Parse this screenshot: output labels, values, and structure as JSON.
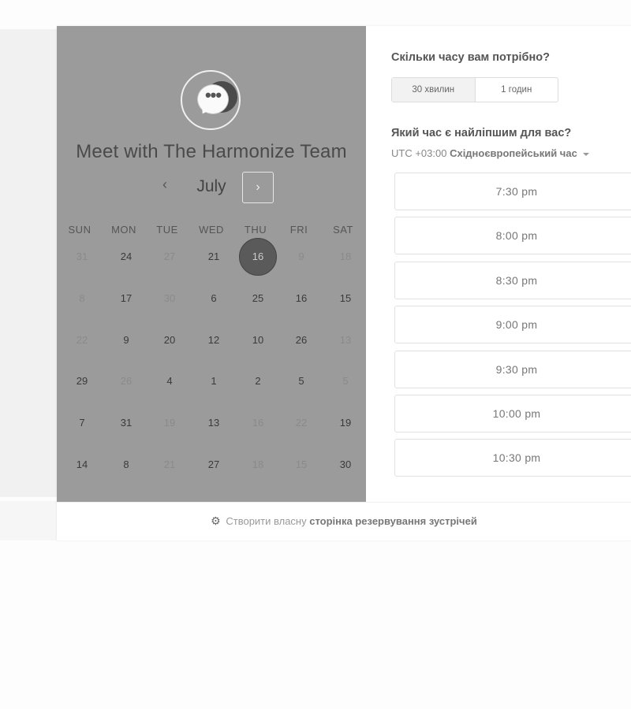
{
  "calendar": {
    "title": "Meet with The Harmonize Team",
    "month": "July",
    "prev_icon": "‹",
    "next_icon": "›",
    "weekdays": [
      "SUN",
      "MON",
      "TUE",
      "WED",
      "THU",
      "FRI",
      "SAT"
    ],
    "days": [
      [
        {
          "t": "31",
          "m": true
        },
        {
          "t": "24",
          "m": false
        },
        {
          "t": "27",
          "m": true
        },
        {
          "t": "21",
          "m": false
        },
        {
          "t": "16",
          "m": false,
          "sel": true
        },
        {
          "t": "9",
          "m": true
        },
        {
          "t": "18",
          "m": true
        }
      ],
      [
        {
          "t": "8",
          "m": true
        },
        {
          "t": "17",
          "m": false
        },
        {
          "t": "30",
          "m": true
        },
        {
          "t": "6",
          "m": false
        },
        {
          "t": "25",
          "m": false
        },
        {
          "t": "16",
          "m": false
        },
        {
          "t": "15",
          "m": false
        }
      ],
      [
        {
          "t": "22",
          "m": true
        },
        {
          "t": "9",
          "m": false
        },
        {
          "t": "20",
          "m": false
        },
        {
          "t": "12",
          "m": false
        },
        {
          "t": "10",
          "m": false
        },
        {
          "t": "26",
          "m": false
        },
        {
          "t": "13",
          "m": true
        }
      ],
      [
        {
          "t": "29",
          "m": false
        },
        {
          "t": "26",
          "m": true
        },
        {
          "t": "4",
          "m": false
        },
        {
          "t": "1",
          "m": false
        },
        {
          "t": "2",
          "m": false
        },
        {
          "t": "5",
          "m": false
        },
        {
          "t": "5",
          "m": true
        }
      ],
      [
        {
          "t": "7",
          "m": false
        },
        {
          "t": "31",
          "m": false
        },
        {
          "t": "19",
          "m": true
        },
        {
          "t": "13",
          "m": false
        },
        {
          "t": "16",
          "m": true
        },
        {
          "t": "22",
          "m": true
        },
        {
          "t": "19",
          "m": false
        }
      ],
      [
        {
          "t": "14",
          "m": false
        },
        {
          "t": "8",
          "m": false
        },
        {
          "t": "21",
          "m": true
        },
        {
          "t": "27",
          "m": false
        },
        {
          "t": "18",
          "m": true
        },
        {
          "t": "15",
          "m": true
        },
        {
          "t": "30",
          "m": false
        }
      ]
    ]
  },
  "booking": {
    "duration_question": "Скільки часу вам потрібно?",
    "durations": [
      "30 хвилин",
      "1 годин"
    ],
    "selected_duration": "30 хвилин",
    "time_question": "Який час є найліпшим для вас?",
    "tz_offset": "UTC +03:00",
    "tz_name": "Східноєвропейський час",
    "slots": [
      "7:30 pm",
      "8:00 pm",
      "8:30 pm",
      "9:00 pm",
      "9:30 pm",
      "10:00 pm",
      "10:30 pm"
    ]
  },
  "footer": {
    "prefix": "Створити власну",
    "link": "сторінка резервування зустрічей"
  },
  "colors": {
    "left_panel": "#9b9b9b",
    "selected_day": "#5a5a5a"
  }
}
